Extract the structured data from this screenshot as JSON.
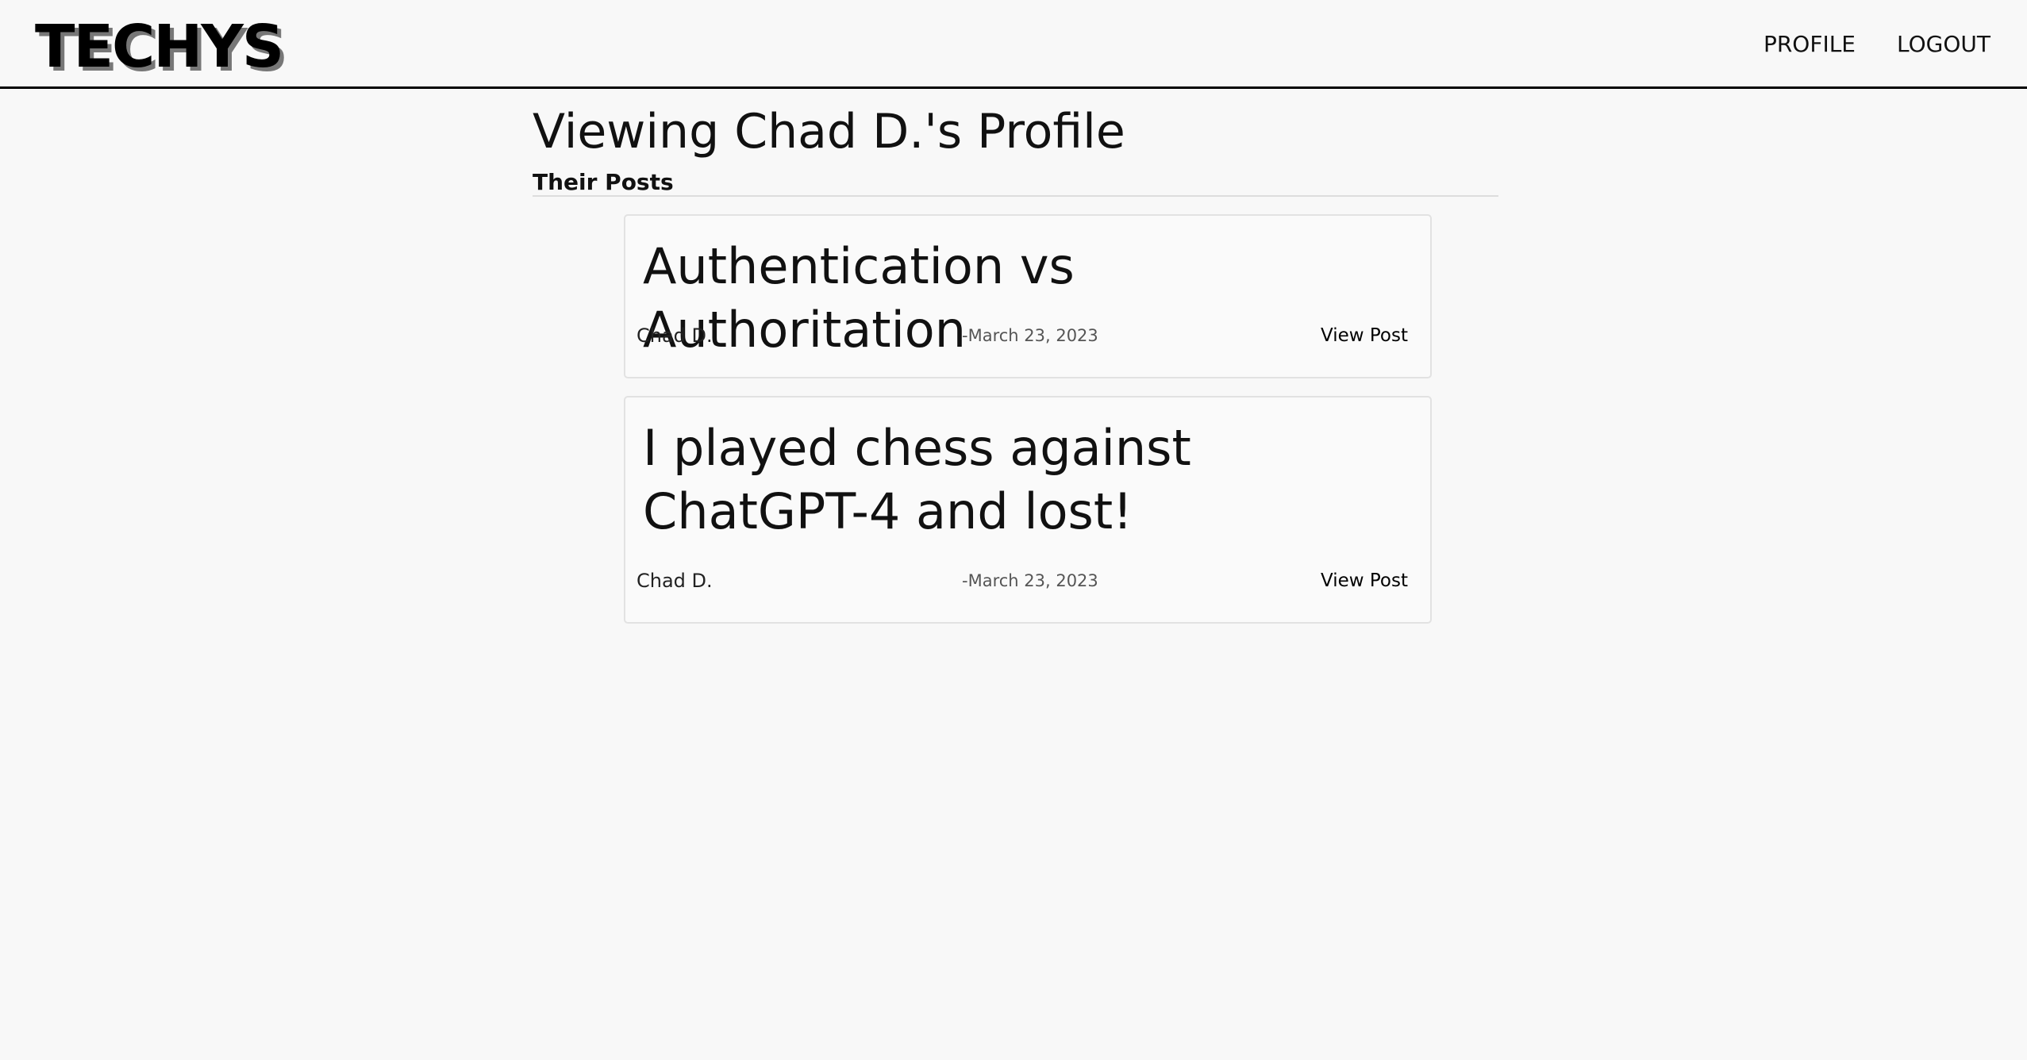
{
  "header": {
    "logo": "TECHYS",
    "nav": [
      {
        "label": "PROFILE"
      },
      {
        "label": "LOGOUT"
      }
    ]
  },
  "main": {
    "title": "Viewing Chad D.'s Profile",
    "section_title": "Their Posts",
    "posts": [
      {
        "title": "Authentication vs Authoritation",
        "author": "Chad D.",
        "date": "-March 23, 2023",
        "link_label": "View Post"
      },
      {
        "title": "I played chess against ChatGPT-4 and lost!",
        "author": "Chad D.",
        "date": "-March 23, 2023",
        "link_label": "View Post"
      }
    ]
  }
}
